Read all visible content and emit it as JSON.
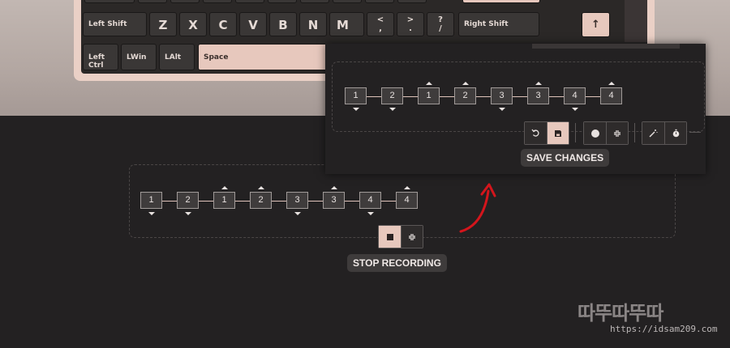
{
  "keyboard": {
    "row_shift": {
      "left_shift": "Left Shift",
      "letters": [
        "Z",
        "X",
        "C",
        "V",
        "B",
        "N",
        "M"
      ],
      "comma": {
        "top": "<",
        "bottom": ","
      },
      "period": {
        "top": ">",
        "bottom": "."
      },
      "slash": {
        "top": "?",
        "bottom": "/"
      },
      "right_shift": "Right Shift",
      "up_arrow": "↑"
    },
    "row_bottom": {
      "left_ctrl": "Left Ctrl",
      "lwin": "LWin",
      "lalt": "LAlt",
      "space": "Space"
    }
  },
  "recording_panel": {
    "steps": [
      {
        "label": "1",
        "dir": "down"
      },
      {
        "label": "2",
        "dir": "down"
      },
      {
        "label": "1",
        "dir": "up"
      },
      {
        "label": "2",
        "dir": "up"
      },
      {
        "label": "3",
        "dir": "down"
      },
      {
        "label": "3",
        "dir": "up"
      },
      {
        "label": "4",
        "dir": "down"
      },
      {
        "label": "4",
        "dir": "up"
      }
    ],
    "stop_icon": "stop-square-icon",
    "shrink_icon": "shrink-arrows-icon",
    "tooltip": "STOP RECORDING"
  },
  "edit_panel": {
    "steps": [
      {
        "label": "1",
        "dir": "down"
      },
      {
        "label": "2",
        "dir": "down"
      },
      {
        "label": "1",
        "dir": "up"
      },
      {
        "label": "2",
        "dir": "up"
      },
      {
        "label": "3",
        "dir": "down"
      },
      {
        "label": "3",
        "dir": "up"
      },
      {
        "label": "4",
        "dir": "down"
      },
      {
        "label": "4",
        "dir": "up"
      }
    ],
    "tooltip": "SAVE CHANGES",
    "icons": [
      "undo-icon",
      "save-icon",
      "record-icon",
      "shrink-arrows-icon",
      "magic-wand-icon",
      "stopwatch-icon"
    ]
  },
  "watermark": {
    "logo": "따뚜따뚜따",
    "url": "https://idsam209.com"
  },
  "colors": {
    "accent": "#e7c8bd",
    "background": "#232122",
    "arrow_red": "#d4151c"
  }
}
